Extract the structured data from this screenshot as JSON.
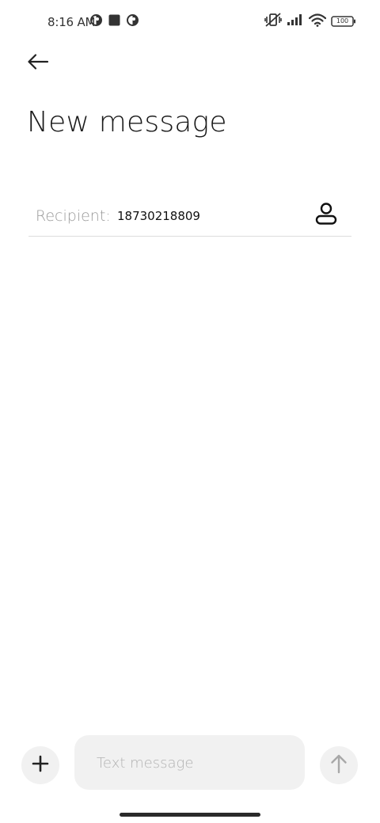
{
  "status_bar": {
    "time": "8:16 AM",
    "battery_level": "100"
  },
  "header": {
    "back_icon": "arrow-left-icon",
    "title": "New message"
  },
  "recipient": {
    "label": "Recipient:",
    "value": "18730218809",
    "contact_icon": "person-icon"
  },
  "composer": {
    "add_icon": "plus-icon",
    "placeholder": "Text message",
    "send_icon": "arrow-up-icon"
  },
  "colors": {
    "background": "#ffffff",
    "input_bg": "#f1f1f1",
    "label_gray": "#9a9a9a",
    "divider": "#dcdcdc"
  }
}
